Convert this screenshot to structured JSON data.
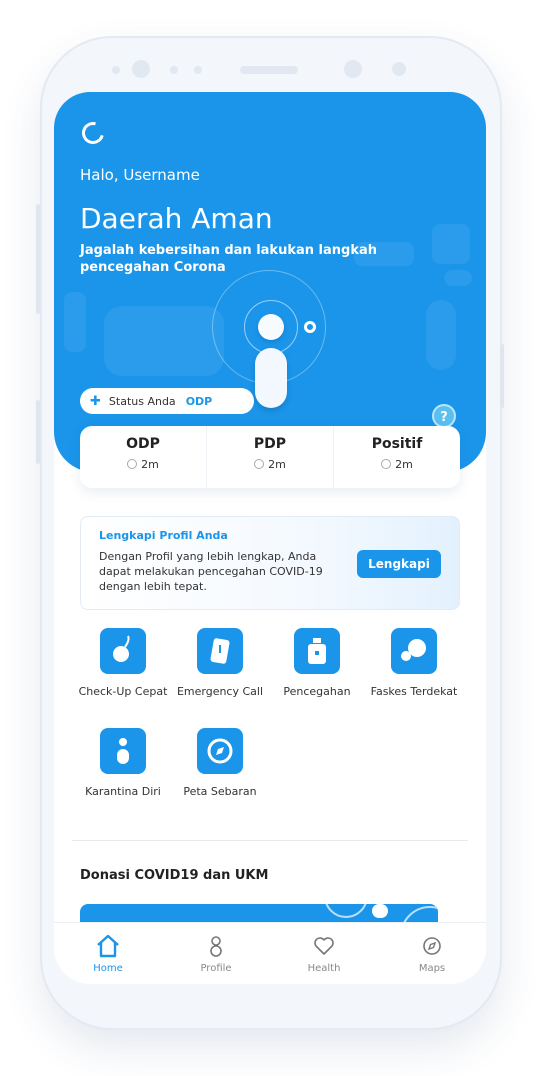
{
  "header": {
    "greeting": "Halo, Username",
    "zone_title": "Daerah Aman",
    "zone_subtitle": "Jagalah kebersihan dan lakukan langkah pencegahan Corona"
  },
  "status": {
    "label": "Status Anda",
    "value": "ODP"
  },
  "stats": [
    {
      "label": "ODP",
      "time": "2m"
    },
    {
      "label": "PDP",
      "time": "2m"
    },
    {
      "label": "Positif",
      "time": "2m"
    }
  ],
  "profile_card": {
    "title": "Lengkapi Profil Anda",
    "body": "Dengan Profil yang lebih lengkap, Anda dapat melakukan pencegahan COVID-19 dengan lebih tepat.",
    "button": "Lengkapi"
  },
  "features": [
    {
      "label": "Check-Up Cepat",
      "icon": "stethoscope-icon"
    },
    {
      "label": "Emergency Call",
      "icon": "phone-icon"
    },
    {
      "label": "Pencegahan",
      "icon": "sanitizer-icon"
    },
    {
      "label": "Faskes Terdekat",
      "icon": "pill-icon"
    },
    {
      "label": "Karantina Diri",
      "icon": "person-icon"
    },
    {
      "label": "Peta Sebaran",
      "icon": "compass-icon"
    }
  ],
  "donation": {
    "title": "Donasi COVID19 dan UKM"
  },
  "nav": [
    {
      "label": "Home",
      "icon": "home-icon",
      "active": true
    },
    {
      "label": "Profile",
      "icon": "profile-icon",
      "active": false
    },
    {
      "label": "Health",
      "icon": "heart-icon",
      "active": false
    },
    {
      "label": "Maps",
      "icon": "compass-icon",
      "active": false
    }
  ],
  "colors": {
    "primary": "#1a95ea",
    "accent_light": "#59c0ef"
  }
}
